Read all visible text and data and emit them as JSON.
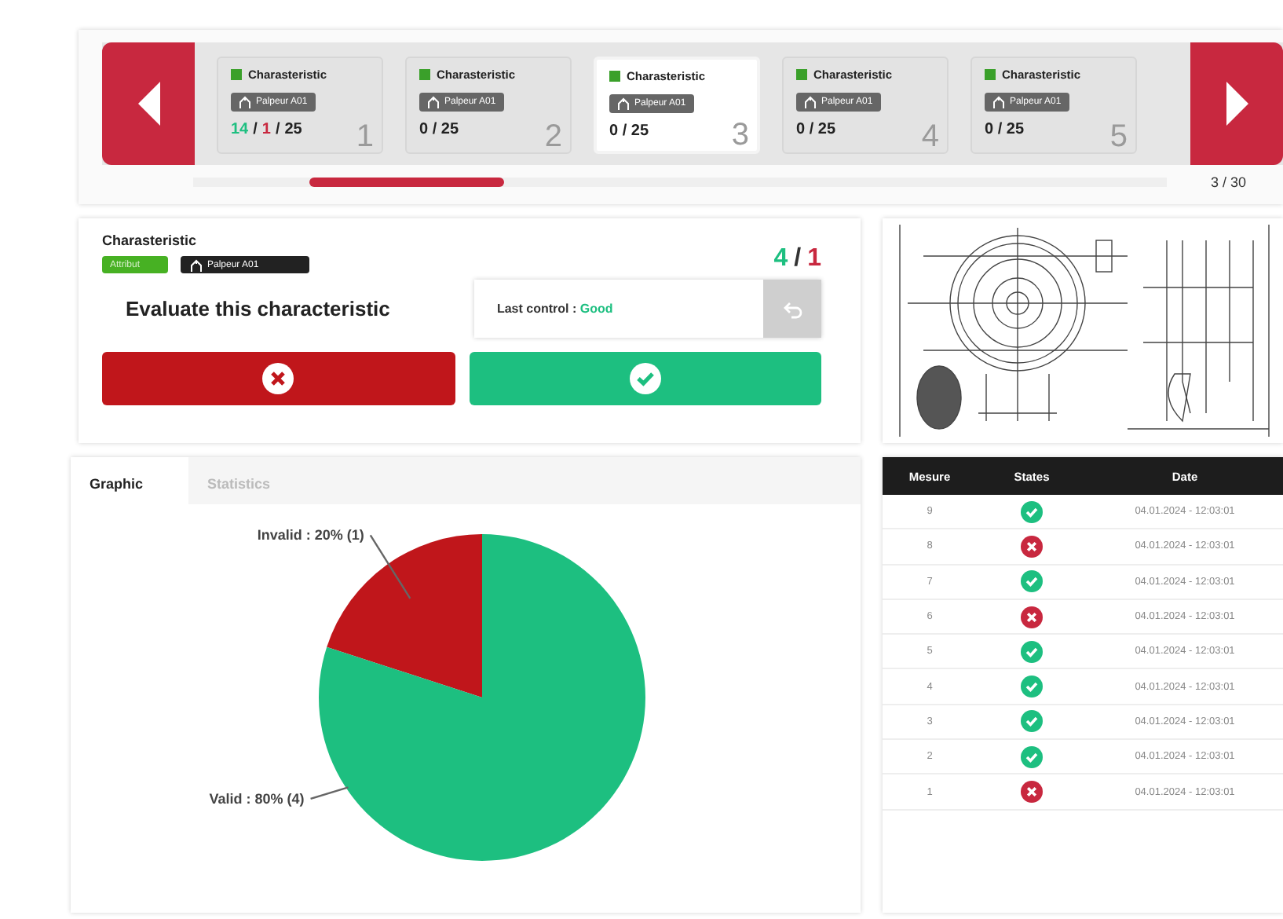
{
  "carousel": {
    "cards": [
      {
        "title": "Charasteristic",
        "tag": "Palpeur A01",
        "count": [
          {
            "text": "14",
            "kind": "good"
          },
          {
            "text": "/",
            "kind": "plain"
          },
          {
            "text": "1",
            "kind": "bad"
          },
          {
            "text": "/",
            "kind": "plain"
          },
          {
            "text": "25",
            "kind": "plain"
          }
        ],
        "number": "1",
        "selected": false
      },
      {
        "title": "Charasteristic",
        "tag": "Palpeur A01",
        "count": [
          {
            "text": "0 / 25",
            "kind": "plain"
          }
        ],
        "number": "2",
        "selected": false
      },
      {
        "title": "Charasteristic",
        "tag": "Palpeur A01",
        "count": [
          {
            "text": "0 / 25",
            "kind": "plain"
          }
        ],
        "number": "3",
        "selected": true
      },
      {
        "title": "Charasteristic",
        "tag": "Palpeur A01",
        "count": [
          {
            "text": "0 / 25",
            "kind": "plain"
          }
        ],
        "number": "4",
        "selected": false
      },
      {
        "title": "Charasteristic",
        "tag": "Palpeur A01",
        "count": [
          {
            "text": "0 / 25",
            "kind": "plain"
          }
        ],
        "number": "5",
        "selected": false
      }
    ],
    "scroll": {
      "level": 0.2
    },
    "page": "3 / 30"
  },
  "evaluation": {
    "title": "Charasteristic",
    "type_tag": "Attribut",
    "probe_tag": "Palpeur A01",
    "score": [
      {
        "text": "4",
        "kind": "good"
      },
      {
        "text": "/",
        "kind": "plain"
      },
      {
        "text": "1",
        "kind": "bad"
      }
    ],
    "prompt": "Evaluate this characteristic",
    "last_control_label": "Last control :",
    "last_control_value": "Good"
  },
  "tabs": [
    {
      "label": "Graphic",
      "selected": true
    },
    {
      "label": "Statistics",
      "selected": false
    }
  ],
  "chart_data": {
    "type": "pie",
    "values": [
      20,
      80
    ],
    "colors": [
      "#c0161b",
      "#1dbf80"
    ],
    "value_labels": [
      "Invalid : 20% (1)",
      "Valid : 80% (4)"
    ]
  },
  "table": {
    "columns": [
      "Mesure",
      "States",
      "Date"
    ],
    "rows": [
      {
        "mesure": "9",
        "valid": true,
        "date": "04.01.2024 - 12:03:01"
      },
      {
        "mesure": "8",
        "valid": false,
        "date": "04.01.2024 - 12:03:01"
      },
      {
        "mesure": "7",
        "valid": true,
        "date": "04.01.2024 - 12:03:01"
      },
      {
        "mesure": "6",
        "valid": false,
        "date": "04.01.2024 - 12:03:01"
      },
      {
        "mesure": "5",
        "valid": true,
        "date": "04.01.2024 - 12:03:01"
      },
      {
        "mesure": "4",
        "valid": true,
        "date": "04.01.2024 - 12:03:01"
      },
      {
        "mesure": "3",
        "valid": true,
        "date": "04.01.2024 - 12:03:01"
      },
      {
        "mesure": "2",
        "valid": true,
        "date": "04.01.2024 - 12:03:01"
      },
      {
        "mesure": "1",
        "valid": false,
        "date": "04.01.2024 - 12:03:01"
      }
    ]
  }
}
